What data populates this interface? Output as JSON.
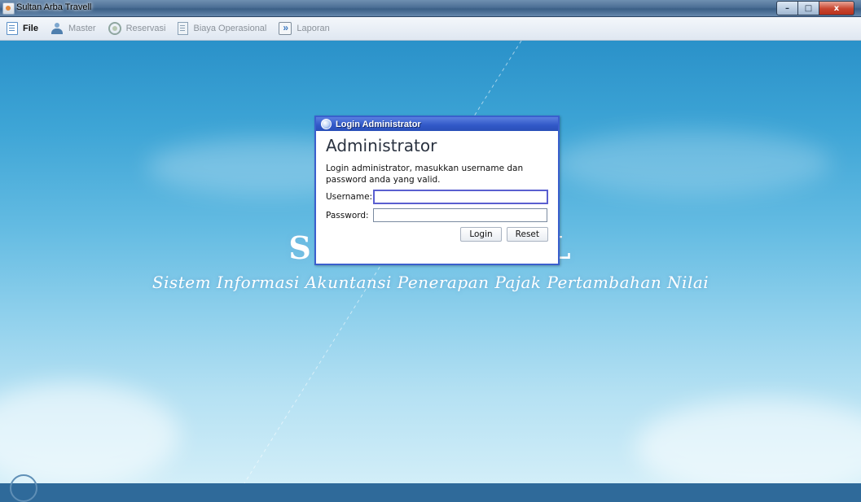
{
  "window": {
    "title": "Sultan Arba Travell",
    "controls": {
      "minimize": "–",
      "maximize": "□",
      "close": "x"
    }
  },
  "menu": {
    "items": [
      {
        "label": "File",
        "icon": "file-icon",
        "enabled": true
      },
      {
        "label": "Master",
        "icon": "master-icon",
        "enabled": false
      },
      {
        "label": "Reservasi",
        "icon": "reservasi-icon",
        "enabled": false
      },
      {
        "label": "Biaya Operasional",
        "icon": "biaya-icon",
        "enabled": false
      },
      {
        "label": "Laporan",
        "icon": "laporan-icon",
        "enabled": false
      }
    ]
  },
  "background": {
    "brand_title": "S",
    "brand_title_tail": "L",
    "brand_subtitle": "Sistem Informasi Akuntansi Penerapan Pajak Pertambahan Nilai"
  },
  "login_dialog": {
    "title": "Login Administrator",
    "heading": "Administrator",
    "description": "Login administrator, masukkan username dan password anda yang valid.",
    "username_label": "Username:",
    "username_value": "",
    "password_label": "Password:",
    "password_value": "",
    "login_button": "Login",
    "reset_button": "Reset",
    "accent_color": "#3058c7"
  }
}
